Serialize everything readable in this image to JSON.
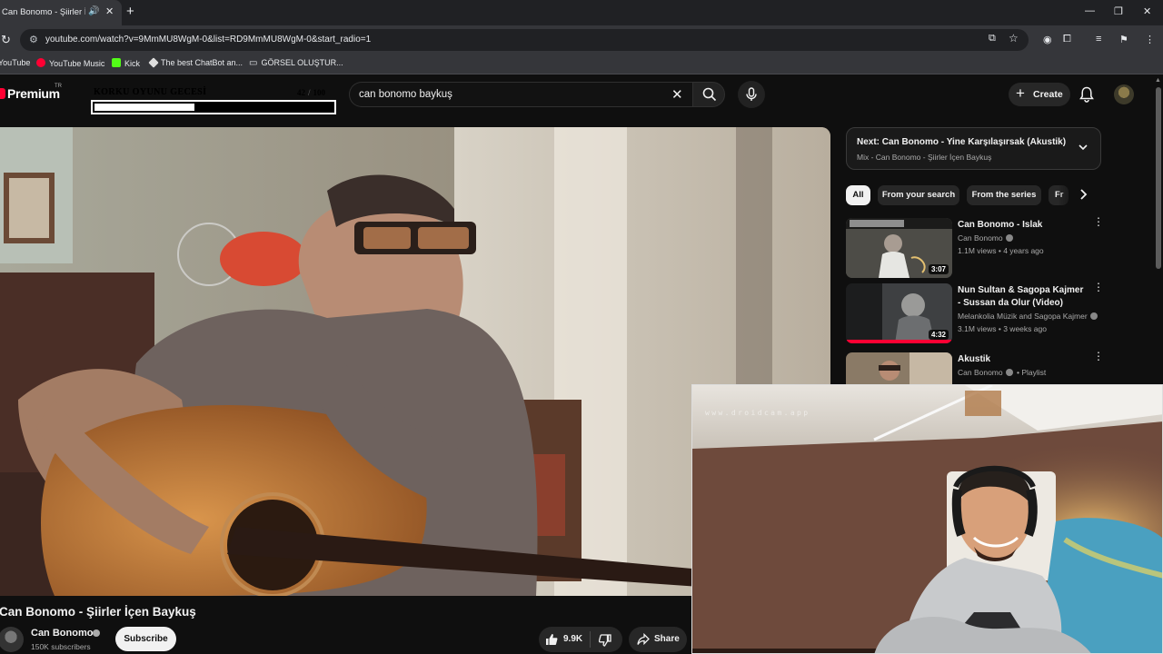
{
  "browser": {
    "tab": {
      "title": "Can Bonomo - Şiirler İçen Baykuş"
    },
    "url": "youtube.com/watch?v=9MmMU8WgM-0&list=RD9MmMU8WgM-0&start_radio=1",
    "bookmarks": [
      {
        "label": "YouTube"
      },
      {
        "label": "YouTube Music"
      },
      {
        "label": "Kick"
      },
      {
        "label": "The best ChatBot an..."
      },
      {
        "label": "GÖRSEL OLUŞTUR..."
      }
    ]
  },
  "youtube": {
    "logo": {
      "text": "Premium",
      "region": "TR"
    },
    "search": {
      "query": "can bonomo baykuş"
    },
    "header": {
      "create_label": "Create"
    }
  },
  "overlay": {
    "title": "KORKU OYUNU GECESİ",
    "current": "42",
    "total": "100",
    "progress": 0.42
  },
  "video": {
    "title": "Can Bonomo - Şiirler İçen Baykuş",
    "channel": "Can Bonomo",
    "subscribers": "150K subscribers",
    "subscribe_label": "Subscribe",
    "likes": "9.9K",
    "share_label": "Share"
  },
  "sidebar": {
    "up_next": {
      "title": "Next: Can Bonomo - Yine Karşılaşırsak (Akustik)",
      "subtitle": "Mix - Can Bonomo - Şiirler İçen Baykuş"
    },
    "chips": [
      {
        "label": "All",
        "selected": true
      },
      {
        "label": "From your search"
      },
      {
        "label": "From the series"
      },
      {
        "label": "Fr"
      }
    ],
    "recommendations": [
      {
        "title": "Can Bonomo - Islak",
        "channel": "Can Bonomo",
        "meta": "1.1M views • 4 years ago",
        "duration": "3:07"
      },
      {
        "title": "Nun Sultan & Sagopa Kajmer - Sussan da Olur (Video)",
        "channel": "Melankolia Müzik and Sagopa Kajmer",
        "meta": "3.1M views • 3 weeks ago",
        "duration": "4:32"
      },
      {
        "title": "Akustik",
        "channel": "Can Bonomo",
        "meta": "Playlist"
      }
    ]
  },
  "webcam": {
    "watermark": "www.droidcam.app"
  }
}
